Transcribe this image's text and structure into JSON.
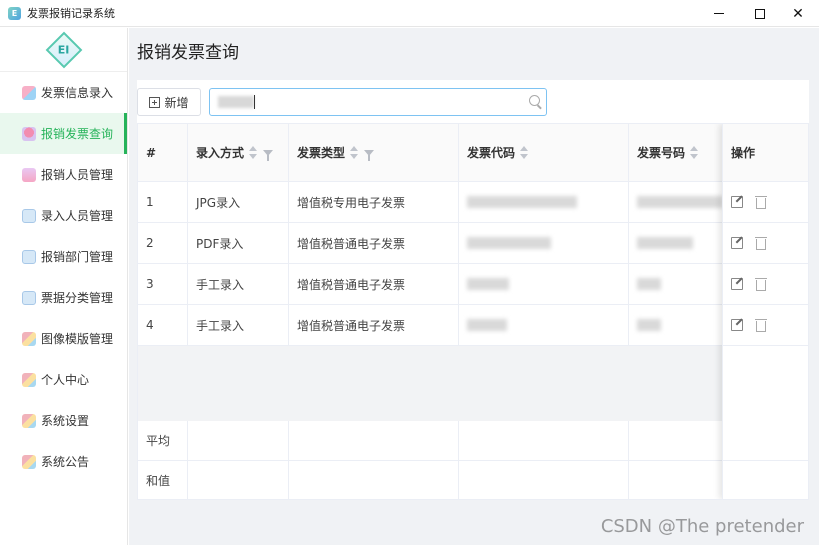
{
  "window": {
    "title": "发票报销记录系统",
    "minimize_icon": "minimize-icon",
    "maximize_icon": "maximize-icon",
    "close_icon": "close-icon"
  },
  "sidebar": {
    "logo_text": "EI",
    "active_color": "#26b35a",
    "items": [
      {
        "label": "发票信息录入",
        "icon": "invoice-entry-icon",
        "active": false
      },
      {
        "label": "报销发票查询",
        "icon": "invoice-query-icon",
        "active": true
      },
      {
        "label": "报销人员管理",
        "icon": "reimburser-icon",
        "active": false
      },
      {
        "label": "录入人员管理",
        "icon": "entry-staff-icon",
        "active": false
      },
      {
        "label": "报销部门管理",
        "icon": "department-icon",
        "active": false
      },
      {
        "label": "票据分类管理",
        "icon": "category-icon",
        "active": false
      },
      {
        "label": "图像模版管理",
        "icon": "template-icon",
        "active": false
      },
      {
        "label": "个人中心",
        "icon": "user-center-icon",
        "active": false
      },
      {
        "label": "系统设置",
        "icon": "settings-icon",
        "active": false
      },
      {
        "label": "系统公告",
        "icon": "announcement-icon",
        "active": false
      }
    ]
  },
  "main": {
    "page_title": "报销发票查询",
    "toolbar": {
      "new_label": "新增",
      "search_value": "",
      "search_icon": "search-icon"
    },
    "table": {
      "columns": [
        "#",
        "录入方式",
        "发票类型",
        "发票代码",
        "发票号码",
        "操作"
      ],
      "rows": [
        {
          "index": "1",
          "method": "JPG录入",
          "type": "增值税专用电子发票"
        },
        {
          "index": "2",
          "method": "PDF录入",
          "type": "增值税普通电子发票"
        },
        {
          "index": "3",
          "method": "手工录入",
          "type": "增值税普通电子发票"
        },
        {
          "index": "4",
          "method": "手工录入",
          "type": "增值税普通电子发票"
        }
      ],
      "footer": {
        "avg_label": "平均",
        "sum_label": "和值"
      }
    }
  },
  "watermark": "CSDN @The  pretender"
}
